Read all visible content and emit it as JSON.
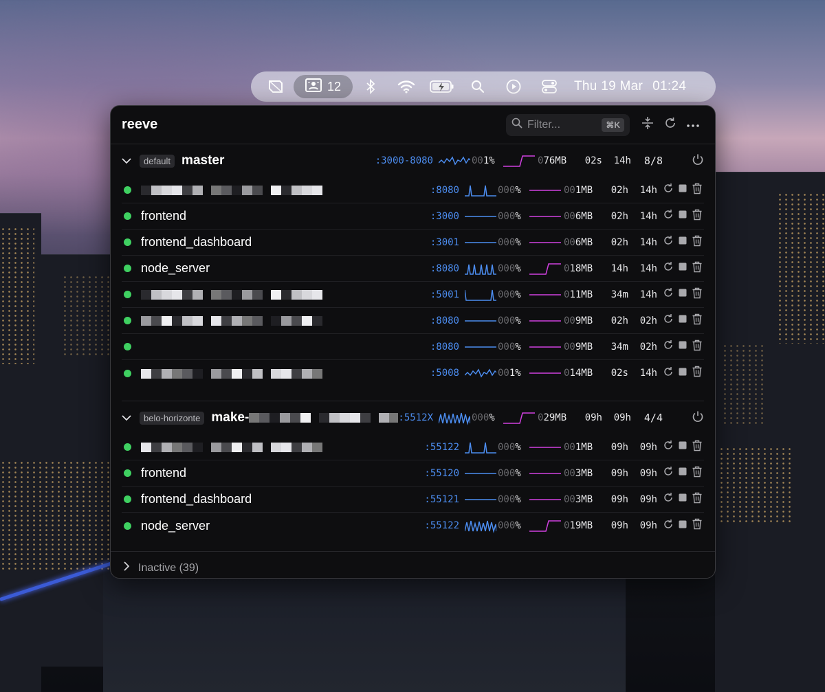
{
  "menubar": {
    "process_count": "12",
    "date": "Thu 19 Mar",
    "time": "01:24",
    "icons": [
      "reeve-icon",
      "processes-icon",
      "bluetooth-icon",
      "wifi-icon",
      "battery-icon",
      "search-icon",
      "play-icon",
      "control-center-icon"
    ]
  },
  "app": {
    "title": "reeve",
    "filter_placeholder": "Filter...",
    "filter_shortcut": "⌘K",
    "header_icons": [
      "collapse-icon",
      "refresh-icon",
      "more-icon"
    ]
  },
  "colors": {
    "accent_blue": "#4c8df0",
    "accent_magenta": "#d040e0",
    "status_green": "#3fd061"
  },
  "groups": [
    {
      "tag": "default",
      "name": "master",
      "ports": ":3000-8080",
      "cpu": "001%",
      "mem": "076MB",
      "t1": "02s",
      "t2": "14h",
      "count": "8/8",
      "cpu_spark": "busy",
      "mem_spark": "step",
      "processes": [
        {
          "name": "",
          "redacted": true,
          "port": ":8080",
          "cpu": "000%",
          "mem": "001MB",
          "t1": "02h",
          "t2": "14h",
          "cpu_spark": "two",
          "mem_spark": "flat"
        },
        {
          "name": "frontend",
          "port": ":3000",
          "cpu": "000%",
          "mem": "006MB",
          "t1": "02h",
          "t2": "14h",
          "cpu_spark": "flat",
          "mem_spark": "flat"
        },
        {
          "name": "frontend_dashboard",
          "port": ":3001",
          "cpu": "000%",
          "mem": "006MB",
          "t1": "02h",
          "t2": "14h",
          "cpu_spark": "flat",
          "mem_spark": "flat"
        },
        {
          "name": "node_server",
          "port": ":8080",
          "cpu": "000%",
          "mem": "018MB",
          "t1": "14h",
          "t2": "14h",
          "cpu_spark": "multi",
          "mem_spark": "step"
        },
        {
          "name": "",
          "redacted": true,
          "port": ":5001",
          "cpu": "000%",
          "mem": "011MB",
          "t1": "34m",
          "t2": "14h",
          "cpu_spark": "edges",
          "mem_spark": "flat"
        },
        {
          "name": "",
          "redacted": true,
          "port": ":8080",
          "cpu": "000%",
          "mem": "009MB",
          "t1": "02h",
          "t2": "02h",
          "cpu_spark": "flat",
          "mem_spark": "flat"
        },
        {
          "name": "",
          "port": ":8080",
          "cpu": "000%",
          "mem": "009MB",
          "t1": "34m",
          "t2": "02h",
          "cpu_spark": "flat",
          "mem_spark": "flat"
        },
        {
          "name": "",
          "redacted": true,
          "port": ":5008",
          "cpu": "001%",
          "mem": "014MB",
          "t1": "02s",
          "t2": "14h",
          "cpu_spark": "busy",
          "mem_spark": "flat"
        }
      ]
    },
    {
      "tag": "belo-horizonte",
      "name": "make-",
      "name_suffix": "...",
      "ports": ":5512X",
      "cpu": "000%",
      "mem": "029MB",
      "t1": "09h",
      "t2": "09h",
      "count": "4/4",
      "cpu_spark": "dense",
      "mem_spark": "step",
      "processes": [
        {
          "name": "",
          "redacted": true,
          "port": ":55122",
          "cpu": "000%",
          "mem": "001MB",
          "t1": "09h",
          "t2": "09h",
          "cpu_spark": "two",
          "mem_spark": "flat"
        },
        {
          "name": "frontend",
          "port": ":55120",
          "cpu": "000%",
          "mem": "003MB",
          "t1": "09h",
          "t2": "09h",
          "cpu_spark": "flat",
          "mem_spark": "flat"
        },
        {
          "name": "frontend_dashboard",
          "port": ":55121",
          "cpu": "000%",
          "mem": "003MB",
          "t1": "09h",
          "t2": "09h",
          "cpu_spark": "flat",
          "mem_spark": "flat"
        },
        {
          "name": "node_server",
          "port": ":55122",
          "cpu": "000%",
          "mem": "019MB",
          "t1": "09h",
          "t2": "09h",
          "cpu_spark": "dense",
          "mem_spark": "step"
        }
      ]
    }
  ],
  "inactive": {
    "label": "Inactive (39)"
  }
}
